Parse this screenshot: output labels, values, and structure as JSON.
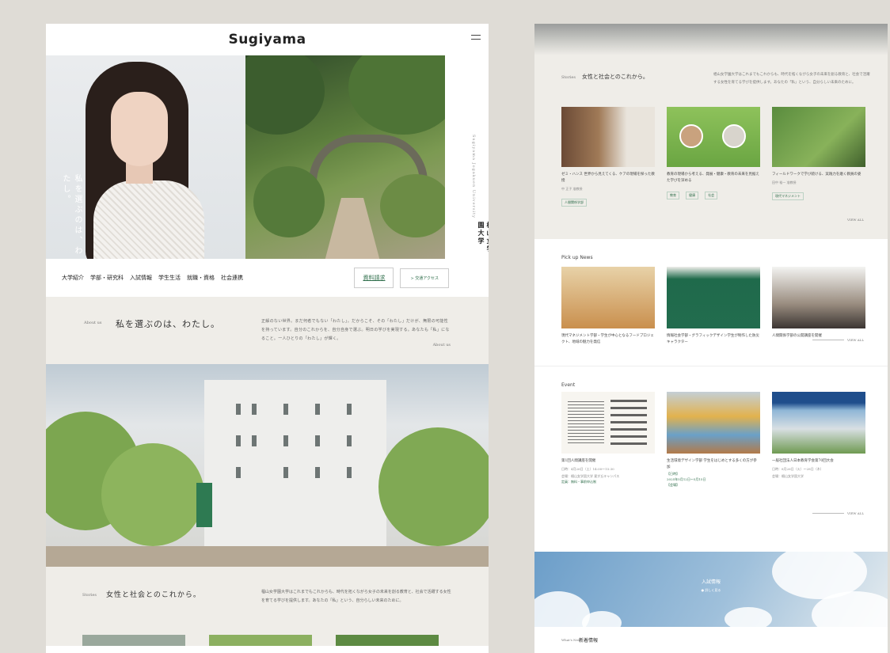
{
  "left": {
    "logo": "Sugiyama",
    "hero": {
      "vertical_text": "私を選ぶのは、わたし。",
      "side_small": "Sugiyama Jogakuen University",
      "side_big": "椙山女学園大学"
    },
    "nav": {
      "items": [
        "大学紹介",
        "学部・研究科",
        "入試情報",
        "学生生活",
        "就職・資格",
        "社会連携"
      ],
      "request": "資料請求",
      "access": "> 交通アクセス"
    },
    "about": {
      "label": "About us",
      "title": "私を選ぶのは、わたし。",
      "text": "正解のない世界。まだ何者でもない「わたし」。だからこそ、その「わたし」だけが、無限の可能性を持っています。自分のこれからを、自分自身で選ぶ。明日の学びを実現する。あなたも「私」になること。一人ひとりの「わたし」が輝く。",
      "link": "About us"
    },
    "stories": {
      "label": "Stories",
      "title": "女性と社会とのこれから。",
      "text": "椙山女学園大学はこれまでもこれからも、時代を拓くながら女子の未来を創る教育と、社会で活躍する女性を育てる学びを提供します。あなたの「私」という、自分らしい未来のために。"
    }
  },
  "right": {
    "stories": {
      "label": "Stories",
      "title": "女性と社会とのこれから。",
      "text": "椙山女学園大学はこれまでもこれからも、時代を拓くながら女子の未来を創る教育と、社会で活躍する女性を育てる学びを提供します。あなたの「私」という、自分らしい未来のために。",
      "cards": [
        {
          "text": "ゼミ・ハンス 世界から見えてくる、ケアの現場を探った教授",
          "meta": "中 正子 准教授",
          "tags": [
            "人間関係学部"
          ]
        },
        {
          "text": "教育の現場から考える、発展・健康・教育の未来を見据えた学びを深める",
          "meta": "",
          "tags": [
            "教育",
            "健康",
            "社会"
          ]
        },
        {
          "text": "フィールドワークで学び続ける、実践力を磨く教員の姿",
          "meta": "田中 裕一 准教授",
          "tags": [
            "現代マネジメント"
          ]
        }
      ],
      "view_all": "VIEW ALL"
    },
    "pickup": {
      "title": "Pick up News",
      "cards": [
        {
          "text": "現代マネジメント学部・学生が中心となるフードプロジェクト、地域の魅力を発信"
        },
        {
          "text": "情報社会学部・グラフィックデザイン学生が制作した防災キャラクター"
        },
        {
          "text": "人間関係学部の公開講座を開催"
        }
      ],
      "view_all": "VIEW ALL"
    },
    "event": {
      "title": "Event",
      "cards": [
        {
          "text": "第1回人間講座を開催",
          "lines": [
            "日時：4月26日（土）14:00〜15:30",
            "会場：椙山女学園大学 星が丘キャンパス",
            "定員：無料・事前申込制"
          ]
        },
        {
          "text": "生活環境デザイン学部 学生をはじめとする多くの方が参加",
          "lines": [
            "【日時】",
            "2025年5月12日〜5月15日",
            "【会場】"
          ]
        },
        {
          "text": "一般社団法人日本教育学会第70回大会",
          "lines": [
            "日時：8月26日（火）〜28日（木）",
            "会場：椙山女学園大学"
          ]
        }
      ],
      "view_all": "VIEW ALL"
    },
    "admission": {
      "title": "入試情報",
      "link": "● 詳しく見る"
    },
    "news": {
      "label": "What's New",
      "title": "新着情報"
    }
  }
}
